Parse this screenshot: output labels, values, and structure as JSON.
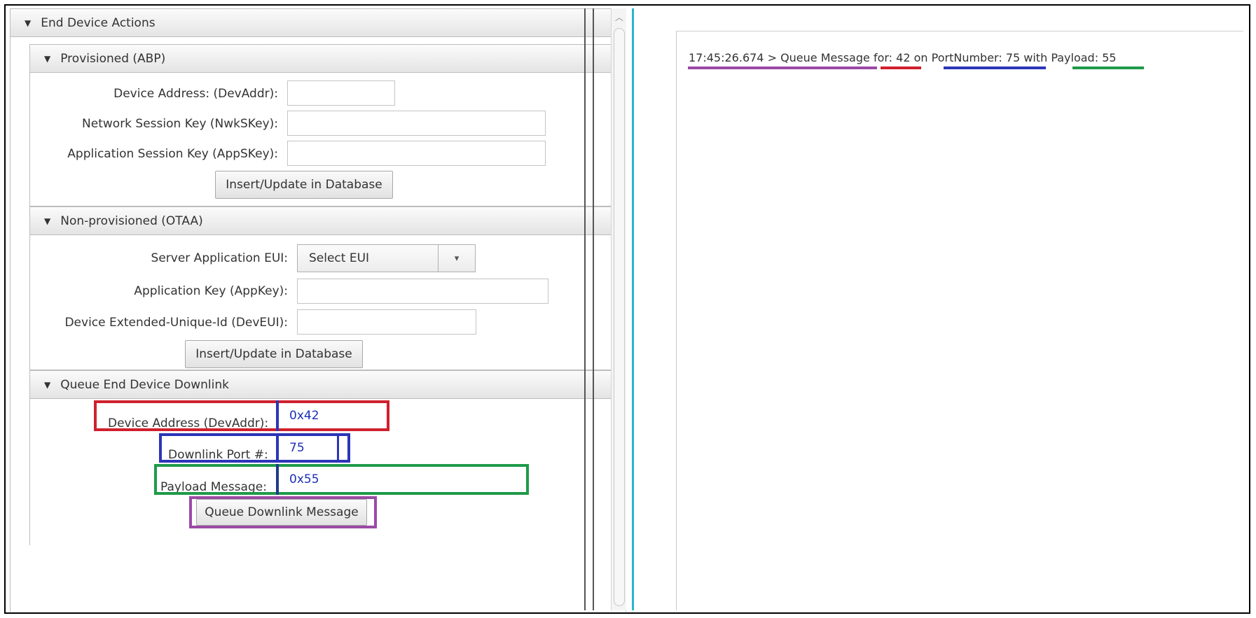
{
  "left_panel": {
    "title": "End Device Actions",
    "collapse_glyph": "▼",
    "sections": {
      "abp": {
        "title": "Provisioned (ABP)",
        "fields": {
          "dev_addr_label": "Device Address: (DevAddr):",
          "dev_addr_value": "",
          "nwk_skey_label": "Network Session Key (NwkSKey):",
          "nwk_skey_value": "",
          "app_skey_label": "Application Session Key (AppSKey):",
          "app_skey_value": ""
        },
        "button_label": "Insert/Update in Database"
      },
      "otaa": {
        "title": "Non-provisioned (OTAA)",
        "fields": {
          "app_eui_label": "Server Application EUI:",
          "app_eui_selected": "Select EUI",
          "app_key_label": "Application Key (AppKey):",
          "app_key_value": "",
          "dev_eui_label": "Device Extended-Unique-Id (DevEUI):",
          "dev_eui_value": ""
        },
        "button_label": "Insert/Update in Database"
      },
      "downlink": {
        "title": "Queue End Device Downlink",
        "fields": {
          "dev_addr_label": "Device Address (DevAddr):",
          "dev_addr_value": "0x42",
          "port_label": "Downlink Port #:",
          "port_value": "75",
          "payload_label": "Payload Message:",
          "payload_value": "0x55"
        },
        "button_label": "Queue Downlink Message"
      }
    }
  },
  "log": {
    "timestamp": "17:45:26.674 > Queue Message",
    "for_part": "for: 42",
    "on_text": "on",
    "port_part": "PortNumber: 75",
    "with_text": "with",
    "payload_part": "Payload: 55"
  },
  "colors": {
    "highlight_red": "#d0202e",
    "highlight_blue": "#2c35b8",
    "highlight_green": "#1f9a4a",
    "highlight_purple": "#9b4aa6",
    "divider_cyan": "#2ab5d0"
  },
  "icons": {
    "collapse": "triangle-down-icon",
    "dropdown": "caret-down-icon",
    "scroll_up": "chevron-up-icon"
  }
}
